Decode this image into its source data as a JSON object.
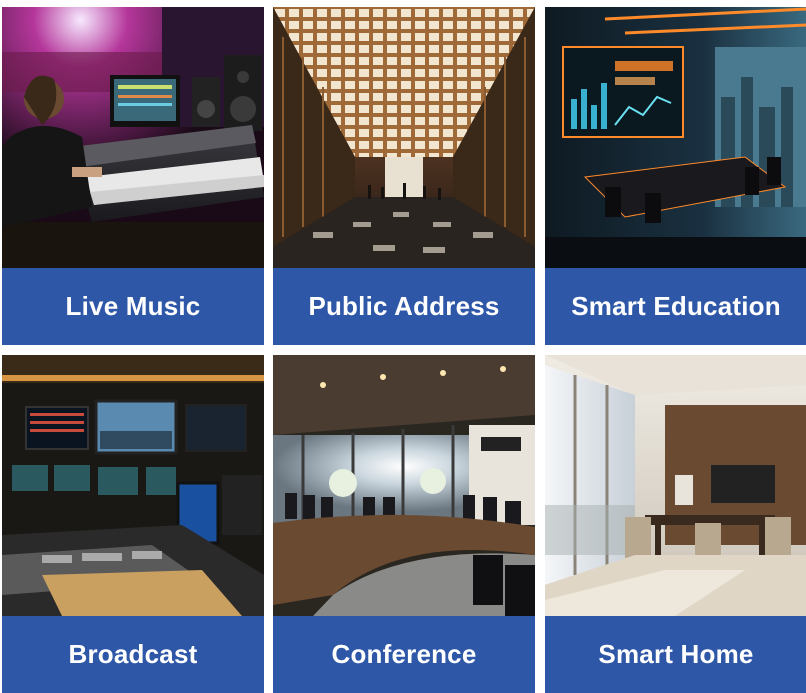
{
  "cards": [
    {
      "label": "Live Music",
      "image": "live-music-mixing-console-photo"
    },
    {
      "label": "Public Address",
      "image": "public-hall-lattice-ceiling-photo"
    },
    {
      "label": "Smart Education",
      "image": "smart-meeting-room-display-photo"
    },
    {
      "label": "Broadcast",
      "image": "broadcast-control-room-photo"
    },
    {
      "label": "Conference",
      "image": "conference-room-table-photo"
    },
    {
      "label": "Smart Home",
      "image": "smart-home-dining-room-photo"
    }
  ],
  "colors": {
    "label_background": "#2e57a8",
    "label_text": "#ffffff",
    "page_background": "#ffffff"
  }
}
